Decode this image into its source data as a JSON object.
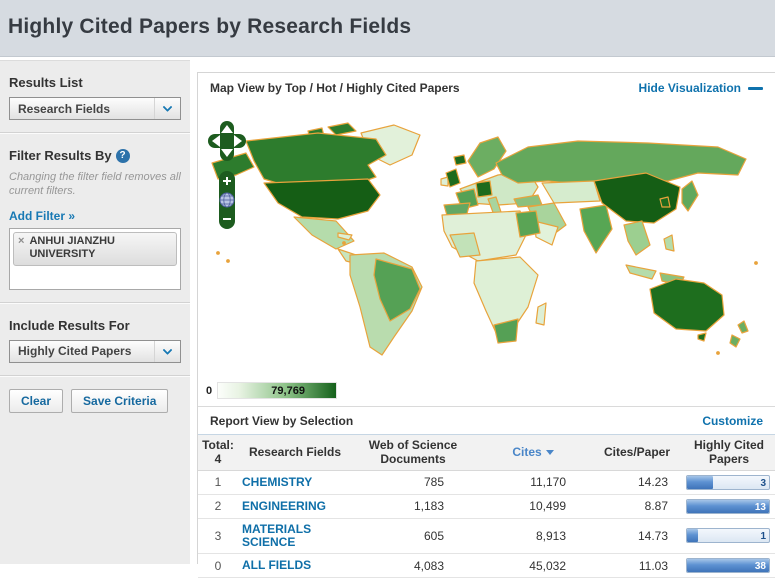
{
  "header": {
    "title": "Highly Cited Papers by Research Fields"
  },
  "sidebar": {
    "results_list_label": "Results List",
    "results_list_value": "Research Fields",
    "filter_label": "Filter Results By",
    "filter_help": "?",
    "filter_note": "Changing the filter field removes all current filters.",
    "add_filter_label": "Add Filter »",
    "filter_tag_remove": "×",
    "filter_tag_label": "ANHUI JIANZHU UNIVERSITY",
    "include_label": "Include Results For",
    "include_value": "Highly Cited Papers",
    "clear_button": "Clear",
    "save_button": "Save Criteria"
  },
  "map": {
    "title": "Map View by Top / Hot / Highly Cited Papers",
    "hide_link": "Hide Visualization",
    "legend_min": "0",
    "legend_max": "79,769",
    "zoom_in": "+",
    "zoom_out": "−"
  },
  "report": {
    "title": "Report View by Selection",
    "customize_link": "Customize",
    "table": {
      "total_label": "Total:",
      "total_value": "4",
      "col_field": "Research Fields",
      "col_docs": "Web of Science Documents",
      "col_cites": "Cites",
      "col_cpp": "Cites/Paper",
      "col_hcp": "Highly Cited Papers",
      "rows": [
        {
          "rank": "1",
          "field": "CHEMISTRY",
          "docs": "785",
          "cites": "11,170",
          "cpp": "14.23",
          "hcp": "3",
          "bar_pct": 32
        },
        {
          "rank": "2",
          "field": "ENGINEERING",
          "docs": "1,183",
          "cites": "10,499",
          "cpp": "8.87",
          "hcp": "13",
          "bar_pct": 100
        },
        {
          "rank": "3",
          "field": "MATERIALS SCIENCE",
          "docs": "605",
          "cites": "8,913",
          "cpp": "14.73",
          "hcp": "1",
          "bar_pct": 14
        },
        {
          "rank": "0",
          "field": "ALL FIELDS",
          "docs": "4,083",
          "cites": "45,032",
          "cpp": "11.03",
          "hcp": "38",
          "bar_pct": 100
        }
      ]
    }
  }
}
